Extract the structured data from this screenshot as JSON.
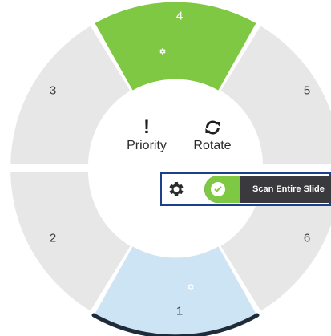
{
  "segments": [
    {
      "id": "1",
      "label": "1",
      "fill": "#cde4f5",
      "state": "selected",
      "cog": true
    },
    {
      "id": "2",
      "label": "2",
      "fill": "#e7e7e7",
      "state": "default",
      "cog": false
    },
    {
      "id": "3",
      "label": "3",
      "fill": "#e7e7e7",
      "state": "default",
      "cog": false
    },
    {
      "id": "4",
      "label": "4",
      "fill": "#7fc843",
      "state": "active",
      "cog": true
    },
    {
      "id": "5",
      "label": "5",
      "fill": "#e7e7e7",
      "state": "default",
      "cog": false
    },
    {
      "id": "6",
      "label": "6",
      "fill": "#e7e7e7",
      "state": "default",
      "cog": false
    }
  ],
  "center": {
    "priority": {
      "label": "Priority",
      "icon": "exclamation-icon",
      "glyph": "!"
    },
    "rotate": {
      "label": "Rotate",
      "icon": "refresh-icon"
    }
  },
  "scan": {
    "label": "Scan Entire Slide",
    "enabled": true,
    "settings_icon": "gear-icon",
    "check_icon": "check-icon"
  },
  "colors": {
    "accent_green": "#7fc843",
    "selected_blue": "#cde4f5",
    "panel_border": "#1e3f8a",
    "toggle_dark": "#3a3a3e",
    "segment_grey": "#e7e7e7"
  }
}
